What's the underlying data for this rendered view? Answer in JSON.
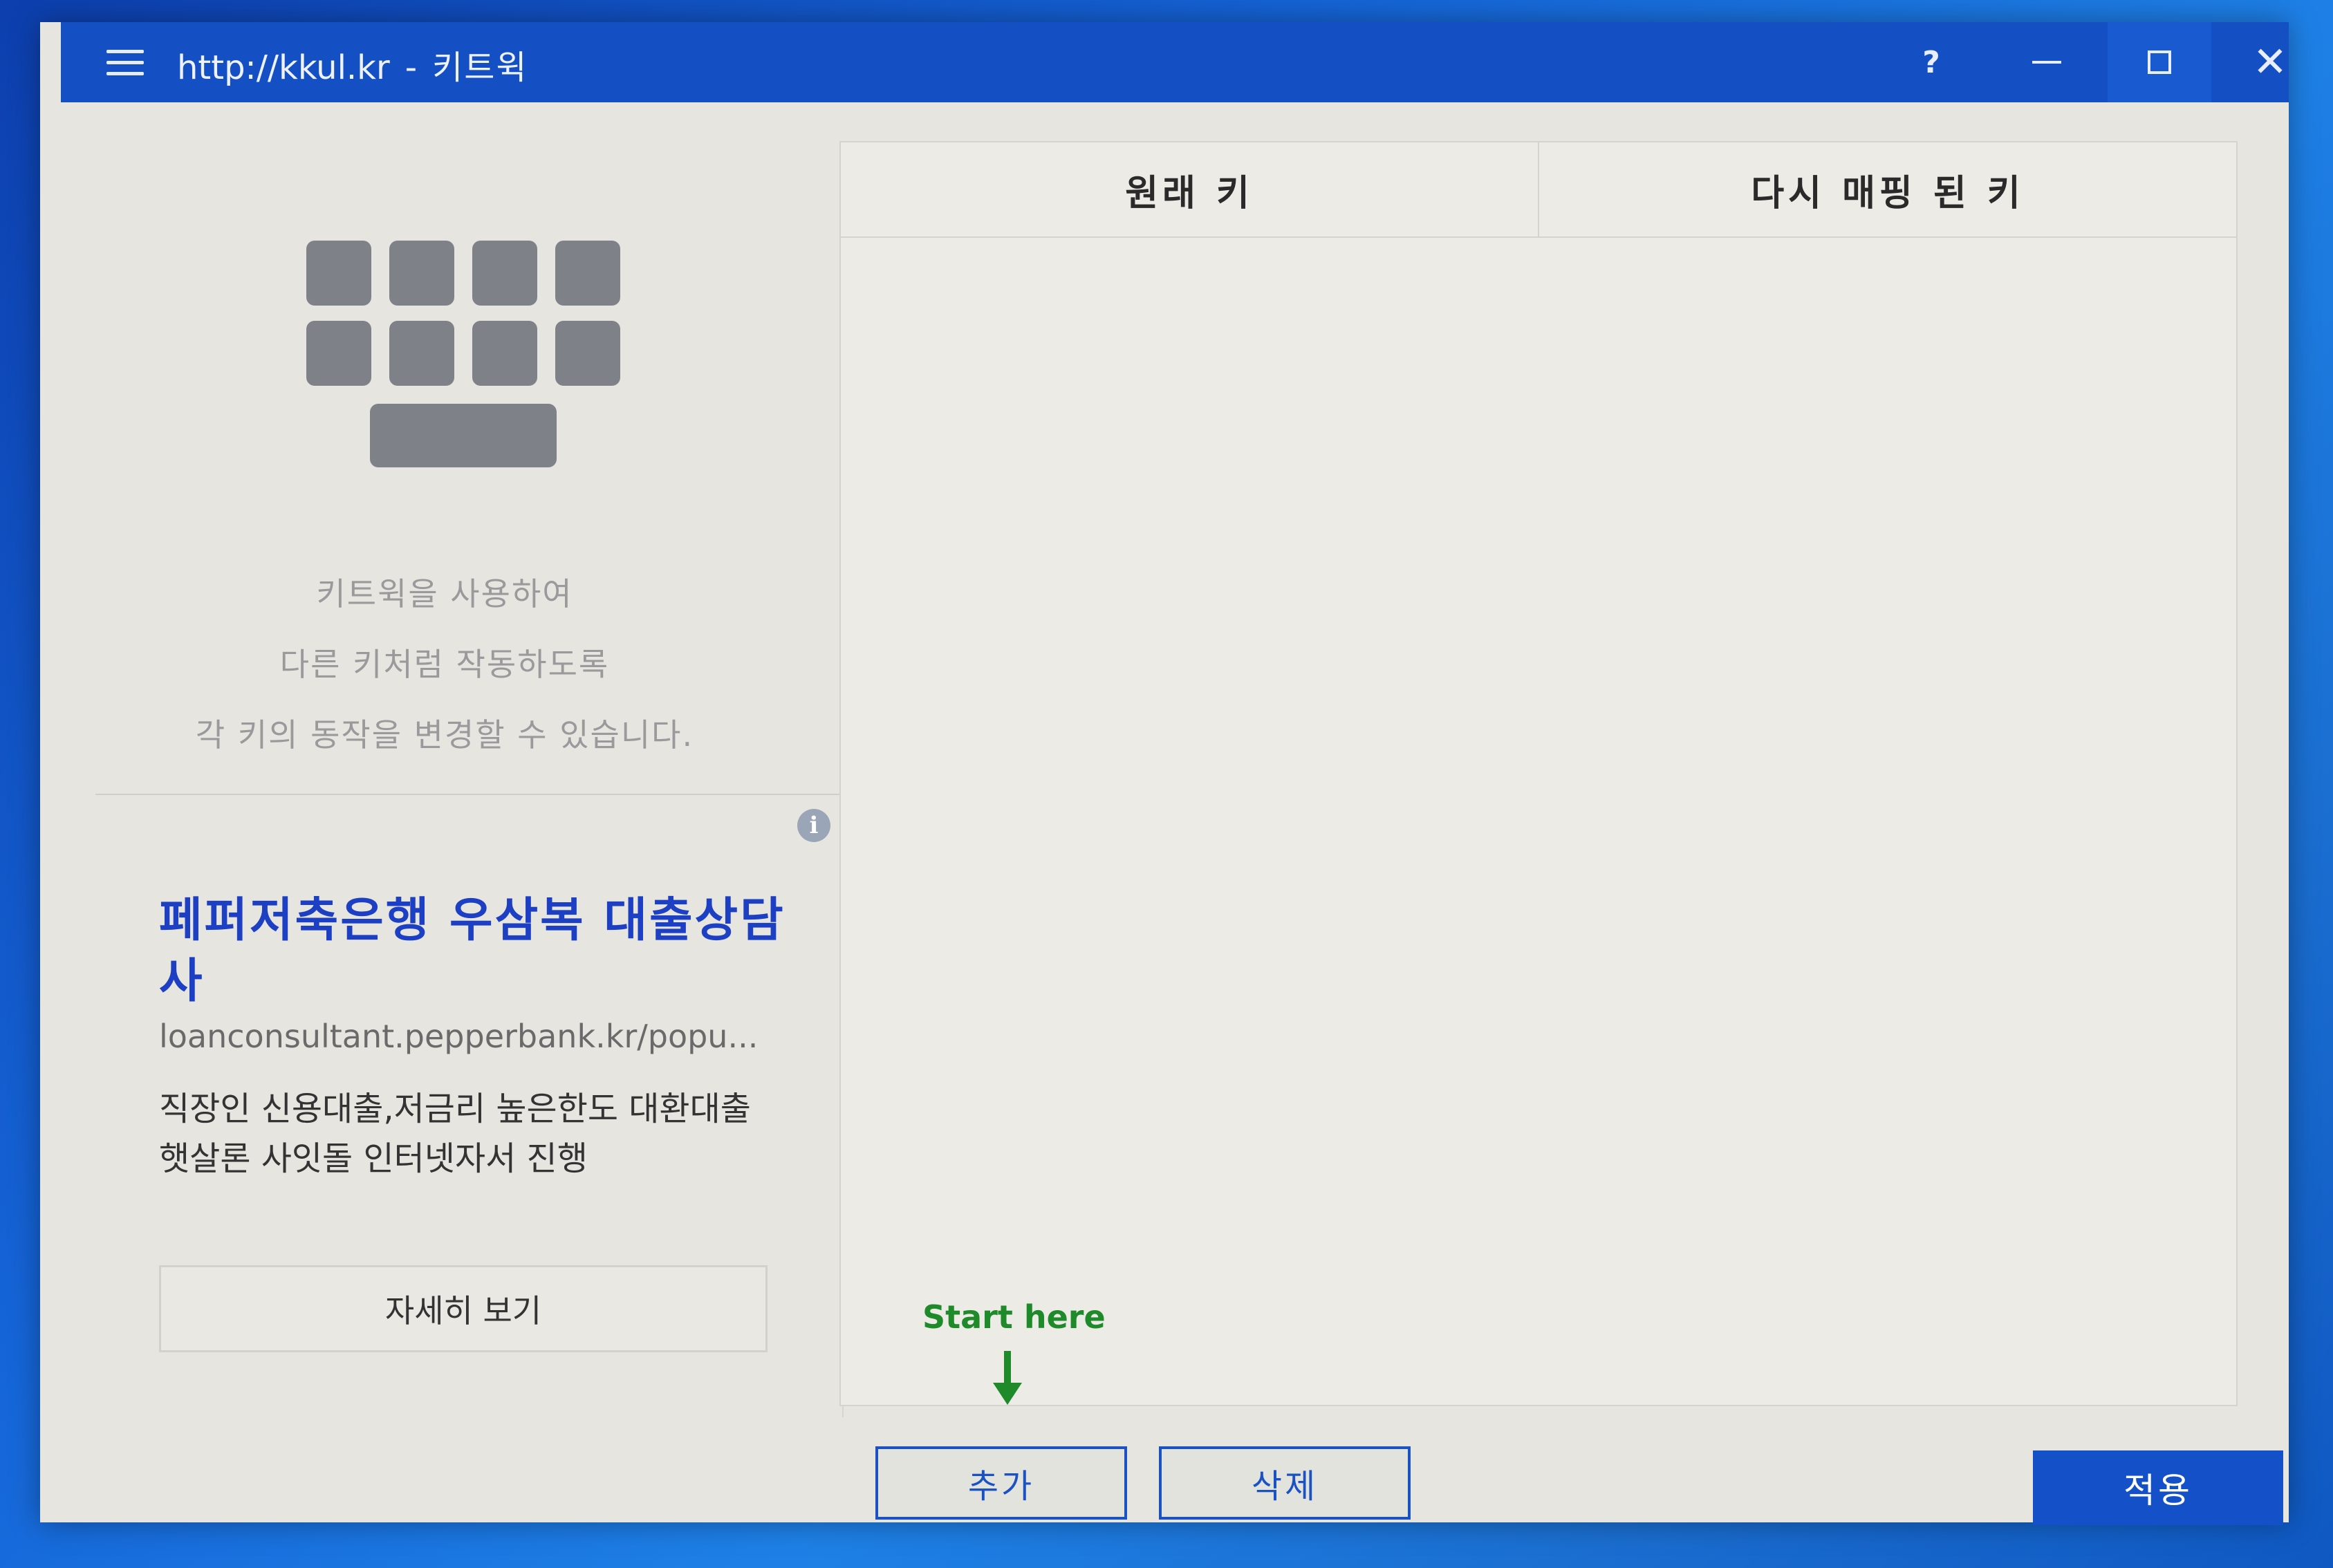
{
  "titlebar": {
    "url": "http://kkul.kr",
    "separator": "-",
    "app_name": "키트윅",
    "help_label": "?",
    "close_glyph": "✕"
  },
  "left_pane": {
    "intro_lines": [
      "키트윅을 사용하여",
      "다른 키처럼 작동하도록",
      "각 키의 동작을 변경할 수 있습니다."
    ],
    "ad": {
      "info_glyph": "i",
      "title": "페퍼저축은행 우삼복 대출상담사",
      "url": "loanconsultant.pepperbank.kr/popu...",
      "description": "직장인 신용대출,저금리 높은한도 대환대출 햇살론 사잇돌 인터넷자서 진행",
      "button_label": "자세히 보기"
    }
  },
  "table": {
    "columns": [
      "원래 키",
      "다시 매핑 된 키"
    ],
    "rows": []
  },
  "hint": {
    "text": "Start here"
  },
  "actions": {
    "add_label": "추가",
    "delete_label": "삭제",
    "apply_label": "적용"
  },
  "colors": {
    "titlebar": "#1450c3",
    "accent": "#1a52c4",
    "ad_title": "#1c3fc4",
    "hint": "#1e8a2a"
  },
  "icons": [
    "hamburger-menu-icon",
    "help-icon",
    "minimize-icon",
    "maximize-icon",
    "close-icon",
    "keyboard-icon",
    "info-icon",
    "down-arrow-icon"
  ]
}
